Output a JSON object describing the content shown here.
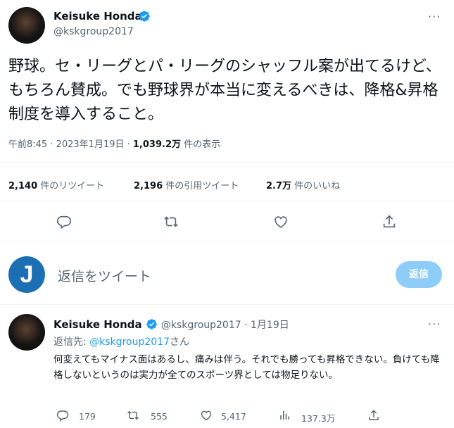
{
  "colors": {
    "accent": "#1d9bf0",
    "text": "#0f1419",
    "muted": "#536471",
    "reply_avatar_bg": "#1d6fb3",
    "reply_button_bg": "#8ecdf8"
  },
  "main_tweet": {
    "author_name": "Keisuke Honda",
    "author_handle": "@kskgroup2017",
    "text": "野球。セ・リーグとパ・リーグのシャッフル案が出てるけど、もちろん賛成。でも野球界が本当に変えるべきは、降格&昇格制度を導入すること。",
    "time": "午前8:45 · 2023年1月19日 · ",
    "views_count": "1,039.2万",
    "views_label": " 件の表示",
    "stats": {
      "retweets_count": "2,140",
      "retweets_label": " 件のリツイート",
      "quotes_count": "2,196",
      "quotes_label": " 件の引用ツイート",
      "likes_count": "2.7万",
      "likes_label": " 件のいいね"
    },
    "actions": [
      "reply-icon",
      "retweet-icon",
      "like-icon",
      "share-icon"
    ]
  },
  "reply_composer": {
    "avatar_letter": "J",
    "placeholder": "返信をツイート",
    "button_label": "返信"
  },
  "reply_tweet": {
    "author_name": "Keisuke Honda",
    "author_handle": "@kskgroup2017",
    "dot": " · ",
    "date": "1月19日",
    "replying_prefix": "返信先: ",
    "replying_handle": "@kskgroup2017",
    "replying_suffix": "さん",
    "text": "何変えてもマイナス面はあるし、痛みは伴う。それでも勝っても昇格できない。負けても降格しないというのは実力が全てのスポーツ界としては物足りない。",
    "replies": "179",
    "retweets": "555",
    "likes": "5,417",
    "views": "137.3万"
  }
}
